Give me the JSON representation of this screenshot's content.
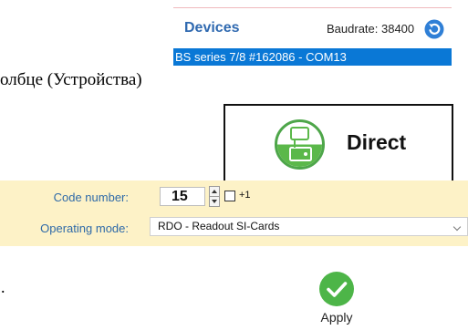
{
  "devices": {
    "title": "Devices",
    "baudrate_label": "Baudrate: 38400",
    "refresh_icon": "refresh-icon",
    "selected_device": "BS series 7/8 #162086 - COM13"
  },
  "document": {
    "text_fragment": "олбце (Устройства)",
    "trailing_dot": "."
  },
  "direct_button": {
    "label": "Direct",
    "icon": "si-card-reader-icon"
  },
  "settings": {
    "code_number_label": "Code number:",
    "code_number_value": "15",
    "plus_one_label": "+1",
    "plus_one_checked": false,
    "operating_mode_label": "Operating mode:",
    "operating_mode_value": "RDO - Readout SI-Cards"
  },
  "apply": {
    "label": "Apply",
    "icon": "checkmark-icon"
  },
  "colors": {
    "accent_blue": "#2f69b0",
    "selection_blue": "#0a78d6",
    "strip_yellow": "#fdf2c7",
    "apply_green": "#4db548",
    "direct_green": "#5bb84a"
  }
}
